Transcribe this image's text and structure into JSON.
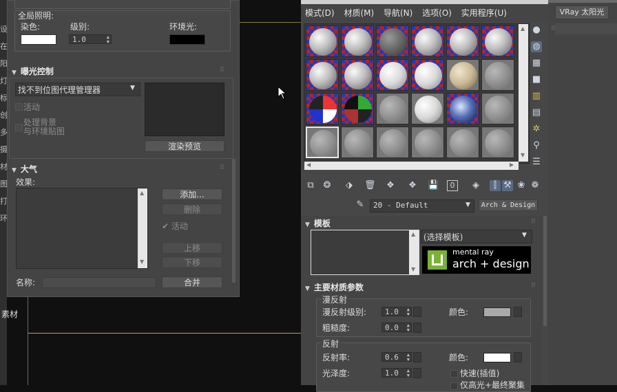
{
  "sidebar_letters": [
    "设",
    "在",
    "阳",
    "灯",
    "标",
    "创",
    "多",
    "摄",
    "材",
    "图",
    "打",
    "环"
  ],
  "left_bottom_label": "素材",
  "env": {
    "global_light_label": "全局照明:",
    "tint_label": "染色:",
    "level_label": "级别:",
    "level_value": "1.0",
    "ambient_label": "环境光:",
    "exposure_title": "曝光控制",
    "exposure_select": "找不到位图代理管理器",
    "active_label": "活动",
    "process_bg_label": "处理背景\n与环境贴图",
    "render_preview_btn": "渲染预览",
    "atmos_title": "大气",
    "effects_label": "效果:",
    "add_btn": "添加...",
    "delete_btn": "删除",
    "atmos_active": "活动",
    "move_up_btn": "上移",
    "move_down_btn": "下移",
    "name_label": "名称:",
    "merge_btn": "合并"
  },
  "vray_sun_btn": "VRay 太阳光",
  "mated": {
    "menu": [
      "模式(D)",
      "材质(M)",
      "导航(N)",
      "选项(O)",
      "实用程序(U)"
    ],
    "material_name": "20 - Default",
    "material_type": "Arch & Design",
    "templates_title": "模板",
    "template_select": "(选择模板)",
    "logo_brand": "mental ray",
    "logo_text": "arch + design",
    "main_params_title": "主要材质参数",
    "diffuse_group": "漫反射",
    "diffuse_level_label": "漫反射级别:",
    "diffuse_level_value": "1.0",
    "roughness_label": "粗糙度:",
    "roughness_value": "0.0",
    "color_label": "颜色:",
    "reflection_group": "反射",
    "reflectivity_label": "反射率:",
    "reflectivity_value": "0.6",
    "glossiness_label": "光泽度:",
    "glossiness_value": "1.0",
    "color2_label": "颜色:",
    "fast_interp_label": "快速(插值)",
    "highlights_label": "仅高光+最终聚集"
  },
  "colors": {
    "diffuse_swatch": "#a9a9a9",
    "reflection_swatch": "#ffffff",
    "tint_swatch": "#ffffff",
    "ambient_swatch": "#000000",
    "accent_selection": "#e8e8e8"
  }
}
